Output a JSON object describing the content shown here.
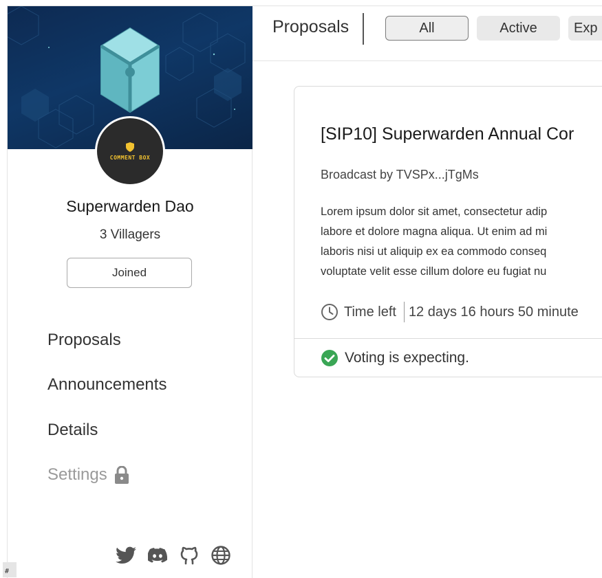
{
  "sidebar": {
    "avatar_text": "COMMENT BOX",
    "dao_name": "Superwarden Dao",
    "villagers": "3 Villagers",
    "join_label": "Joined",
    "nav": [
      {
        "label": "Proposals",
        "icon": null
      },
      {
        "label": "Announcements",
        "icon": null
      },
      {
        "label": "Details",
        "icon": null
      },
      {
        "label": "Settings",
        "icon": "lock-icon",
        "disabled": true
      }
    ],
    "socials": [
      "twitter-icon",
      "discord-icon",
      "github-icon",
      "globe-icon"
    ]
  },
  "header": {
    "title": "Proposals",
    "filters": [
      {
        "label": "All",
        "selected": true
      },
      {
        "label": "Active",
        "selected": false
      },
      {
        "label": "Exp",
        "selected": false
      }
    ]
  },
  "proposal": {
    "title": "[SIP10] Superwarden Annual Cor",
    "author": "Broadcast by TVSPx...jTgMs",
    "body_lines": [
      "Lorem ipsum dolor sit amet, consectetur adip",
      "labore et dolore magna aliqua. Ut enim ad mi",
      "laboris nisi ut aliquip ex ea commodo conseq",
      "voluptate velit esse cillum dolore eu fugiat nu"
    ],
    "time_label": "Time left",
    "time_value": "12 days 16 hours 50 minute",
    "status": "Voting is expecting."
  },
  "corner_badge": "#",
  "colors": {
    "banner": "#0f3766",
    "cube": "#7fd0d8",
    "check": "#3aa655",
    "avatar_bg": "#2b2b2b",
    "avatar_accent": "#f2c230"
  }
}
